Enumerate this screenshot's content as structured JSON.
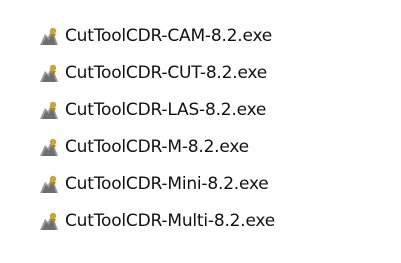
{
  "files": [
    {
      "name": "CutToolCDR-CAM-8.2.exe",
      "icon": "executable-icon"
    },
    {
      "name": "CutToolCDR-CUT-8.2.exe",
      "icon": "executable-icon"
    },
    {
      "name": "CutToolCDR-LAS-8.2.exe",
      "icon": "executable-icon"
    },
    {
      "name": "CutToolCDR-M-8.2.exe",
      "icon": "executable-icon"
    },
    {
      "name": "CutToolCDR-Mini-8.2.exe",
      "icon": "executable-icon"
    },
    {
      "name": "CutToolCDR-Multi-8.2.exe",
      "icon": "executable-icon"
    }
  ],
  "colors": {
    "text": "#111111",
    "icon_body": "#8a8a8a",
    "icon_accent": "#c9a43a"
  }
}
